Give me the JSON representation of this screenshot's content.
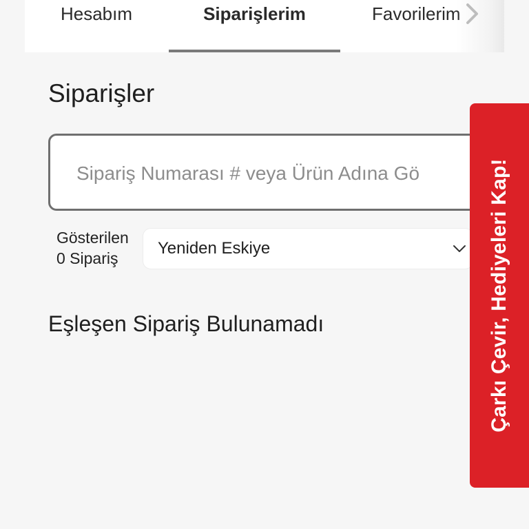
{
  "tabs": {
    "account": "Hesabım",
    "orders": "Siparişlerim",
    "favorites": "Favorilerim"
  },
  "page": {
    "title": "Siparişler"
  },
  "search": {
    "placeholder": "Sipariş Numarası # veya Ürün Adına Gö",
    "value": ""
  },
  "listing": {
    "count_label_line1": "Gösterilen",
    "count_label_line2": "0 Sipariş",
    "sort_selected": "Yeniden Eskiye"
  },
  "empty_state": {
    "message": "Eşleşen Sipariş Bulunamadı"
  },
  "promo": {
    "label": "Çarkı Çevir, Hediyeleri Kap!",
    "background_color": "#dc2127"
  },
  "icons": {
    "tab_scroll": "chevron-right-icon",
    "sort": "chevron-down-icon"
  }
}
